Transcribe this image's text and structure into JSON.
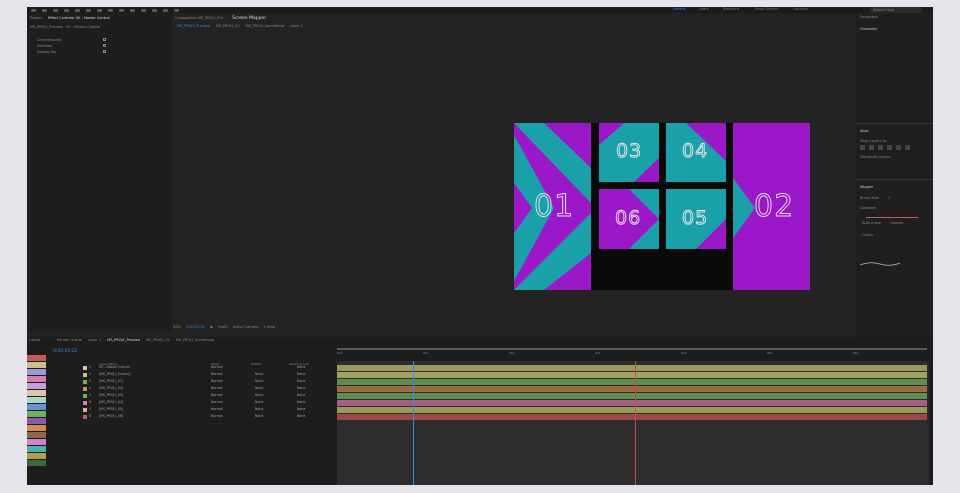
{
  "workspace": {
    "active": "Default",
    "others": [
      "Learn",
      "Standard",
      "Small Screen",
      "Libraries"
    ],
    "search_placeholder": "Search Help"
  },
  "project_panel": {
    "tab": "Effect Controls: 00 - Master Control",
    "subtitle": "MS_PROJ1_Preview · 00 - Master Control",
    "effects": [
      "Checkerboard",
      "Sections",
      "Display No."
    ]
  },
  "composition_tabs": [
    "MS_PROJ1_Preview",
    "MS_PROJ1_02",
    "MS_PROJ1_Something",
    "Layer 1"
  ],
  "composition_header": {
    "label": "Composition MS_PROJ1_Pre...",
    "title": "Screen Mapper"
  },
  "comp_tiles": {
    "t1": "01",
    "t2": "02",
    "t3": "03",
    "t4": "04",
    "t5": "05",
    "t6": "06"
  },
  "viewer_toolbar": {
    "zoom": "50%",
    "timecode": "0:00:03:22",
    "resolution": "(Half)",
    "camera": "Active Camera",
    "views": "1 View"
  },
  "right_panel": {
    "paragraph": "Paragraph",
    "character": "Character",
    "align": "Align",
    "align_to": "Align Layers to:",
    "distribute": "Distribute Layers:",
    "wiggler": "Wiggler",
    "brush": "Brush Size:",
    "brush_value": "1",
    "diameter": "Diameter",
    "spacing": "Spacing",
    "checks": [
      "Auto Erase",
      "Opacity"
    ],
    "colors": "Colors"
  },
  "timeline": {
    "tabs": [
      "Render Queue",
      "Layer 1",
      "MS_PROJ1_Preview",
      "MS_PROJ1_02",
      "MS_PROJ1_Something"
    ],
    "current_time": "0:00:03:22",
    "columns": [
      "Layer Name",
      "Mode",
      "TrkMat",
      "Parent & Link"
    ],
    "ruler": [
      "00s",
      "01s",
      "02s",
      "03s",
      "04s",
      "05s",
      "06s"
    ],
    "layers": [
      {
        "n": "1",
        "name": "00 - Master Control",
        "mode": "Normal",
        "trk": "",
        "parent": "None",
        "color": "#d8c8a8"
      },
      {
        "n": "2",
        "name": "[MS_PROJ1_Screen]",
        "mode": "Normal",
        "trk": "None",
        "parent": "None",
        "color": "#c9c08a"
      },
      {
        "n": "3",
        "name": "[MS_PROJ1_01]",
        "mode": "Normal",
        "trk": "None",
        "parent": "None",
        "color": "#6fb15a"
      },
      {
        "n": "4",
        "name": "[MS_PROJ1_02]",
        "mode": "Normal",
        "trk": "None",
        "parent": "None",
        "color": "#d08f4a"
      },
      {
        "n": "5",
        "name": "[MS_PROJ1_03]",
        "mode": "Normal",
        "trk": "None",
        "parent": "None",
        "color": "#6fb15a"
      },
      {
        "n": "6",
        "name": "[MS_PROJ1_04]",
        "mode": "Normal",
        "trk": "None",
        "parent": "None",
        "color": "#d47fb0"
      },
      {
        "n": "7",
        "name": "[MS_PROJ1_05]",
        "mode": "Normal",
        "trk": "None",
        "parent": "None",
        "color": "#c9c08a"
      },
      {
        "n": "8",
        "name": "[MS_PROJ1_06]",
        "mode": "Normal",
        "trk": "None",
        "parent": "None",
        "color": "#c55a5a"
      }
    ],
    "bar_colors": [
      "#9b9a5c",
      "#a3a263",
      "#5e8d52",
      "#a0693f",
      "#5e8d52",
      "#a55f85",
      "#9b9a5c",
      "#a04848"
    ]
  },
  "labels_panel": {
    "title": "Labels"
  },
  "colors": {
    "purple": "#9b18c9",
    "teal": "#1aa0a8",
    "accent": "#2d8ceb"
  }
}
